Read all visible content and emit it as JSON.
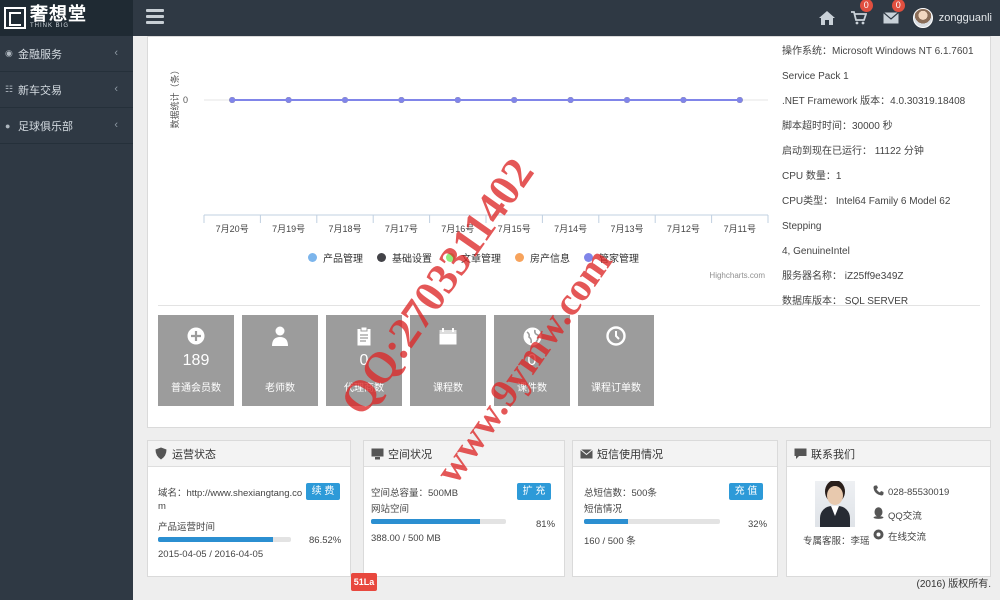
{
  "brand": {
    "name": "奢想堂",
    "sub": "THINK BIG"
  },
  "header": {
    "home_icon": "home-icon",
    "cart_badge": "0",
    "mail_badge": "0",
    "username": "zongguanli"
  },
  "sidebar": {
    "items": [
      {
        "icon": "finance-icon",
        "label": "金融服务"
      },
      {
        "icon": "grid-icon",
        "label": "新车交易"
      },
      {
        "icon": "user-icon",
        "label": "足球俱乐部"
      }
    ]
  },
  "chart_data": {
    "type": "line",
    "ylabel": "数据统计（条）",
    "y_ticks": [
      "0"
    ],
    "categories": [
      "7月20号",
      "7月19号",
      "7月18号",
      "7月17号",
      "7月16号",
      "7月15号",
      "7月14号",
      "7月13号",
      "7月12号",
      "7月11号"
    ],
    "series": [
      {
        "name": "产品管理",
        "color": "#7cb5ec",
        "values": [
          0,
          0,
          0,
          0,
          0,
          0,
          0,
          0,
          0,
          0
        ]
      },
      {
        "name": "基础设置",
        "color": "#434348",
        "values": [
          0,
          0,
          0,
          0,
          0,
          0,
          0,
          0,
          0,
          0
        ]
      },
      {
        "name": "文章管理",
        "color": "#90ed7d",
        "values": [
          0,
          0,
          0,
          0,
          0,
          0,
          0,
          0,
          0,
          0
        ]
      },
      {
        "name": "房产信息",
        "color": "#f7a35c",
        "values": [
          0,
          0,
          0,
          0,
          0,
          0,
          0,
          0,
          0,
          0
        ]
      },
      {
        "name": "管家管理",
        "color": "#8085e9",
        "values": [
          0,
          0,
          0,
          0,
          0,
          0,
          0,
          0,
          0,
          0
        ]
      }
    ],
    "credit": "Highcharts.com"
  },
  "system_info": {
    "lines": [
      "操作系统：Microsoft Windows NT 6.1.7601",
      "Service Pack 1",
      ".NET Framework 版本：4.0.30319.18408",
      "脚本超时时间：30000 秒",
      "启动到现在已运行： 11122 分钟",
      "CPU 数量：1",
      "CPU类型： Intel64 Family 6 Model 62 Stepping",
      "4, GenuineIntel",
      "服务器名称： iZ25ff9e349Z",
      "数据库版本： SQL SERVER"
    ]
  },
  "tiles": [
    {
      "icon": "plus-circle-icon",
      "value": "189",
      "label": "普通会员数"
    },
    {
      "icon": "person-icon",
      "value": "",
      "label": "老师数"
    },
    {
      "icon": "clipboard-icon",
      "value": "0",
      "label": "代理商数"
    },
    {
      "icon": "calendar-icon",
      "value": "",
      "label": "课程数"
    },
    {
      "icon": "globe-icon",
      "value": "0",
      "label": "课件数"
    },
    {
      "icon": "clock-icon",
      "value": "",
      "label": "课程订单数"
    }
  ],
  "operation": {
    "title": "运营状态",
    "domain_line1": "域名：http://www.shexiangtang.co",
    "domain_line2": "m",
    "renew_label": "续 费",
    "time_label": "产品运营时间",
    "percent": "86.52%",
    "progress": 0.8652,
    "range": "2015-04-05 / 2016-04-05"
  },
  "space": {
    "title": "空间状况",
    "total": "空间总容量：500MB",
    "label": "网站空间",
    "expand_label": "扩 充",
    "percent": "81%",
    "progress": 0.81,
    "usage": "388.00 / 500 MB"
  },
  "sms": {
    "title": "短信使用情况",
    "total": "总短信数：500条",
    "label": "短信情况",
    "recharge_label": "充 值",
    "percent": "32%",
    "progress": 0.32,
    "usage": "160 / 500 条"
  },
  "contact": {
    "title": "联系我们",
    "phone": "028-85530019",
    "qq": "QQ交流",
    "online": "在线交流",
    "agent": "专属客服：李瑶"
  },
  "footer": {
    "copyright": "(2016) 版权所有.",
    "tag": "51La"
  },
  "watermark": {
    "qq": "QQ:2703311402",
    "site": "www.9ymw.com"
  }
}
